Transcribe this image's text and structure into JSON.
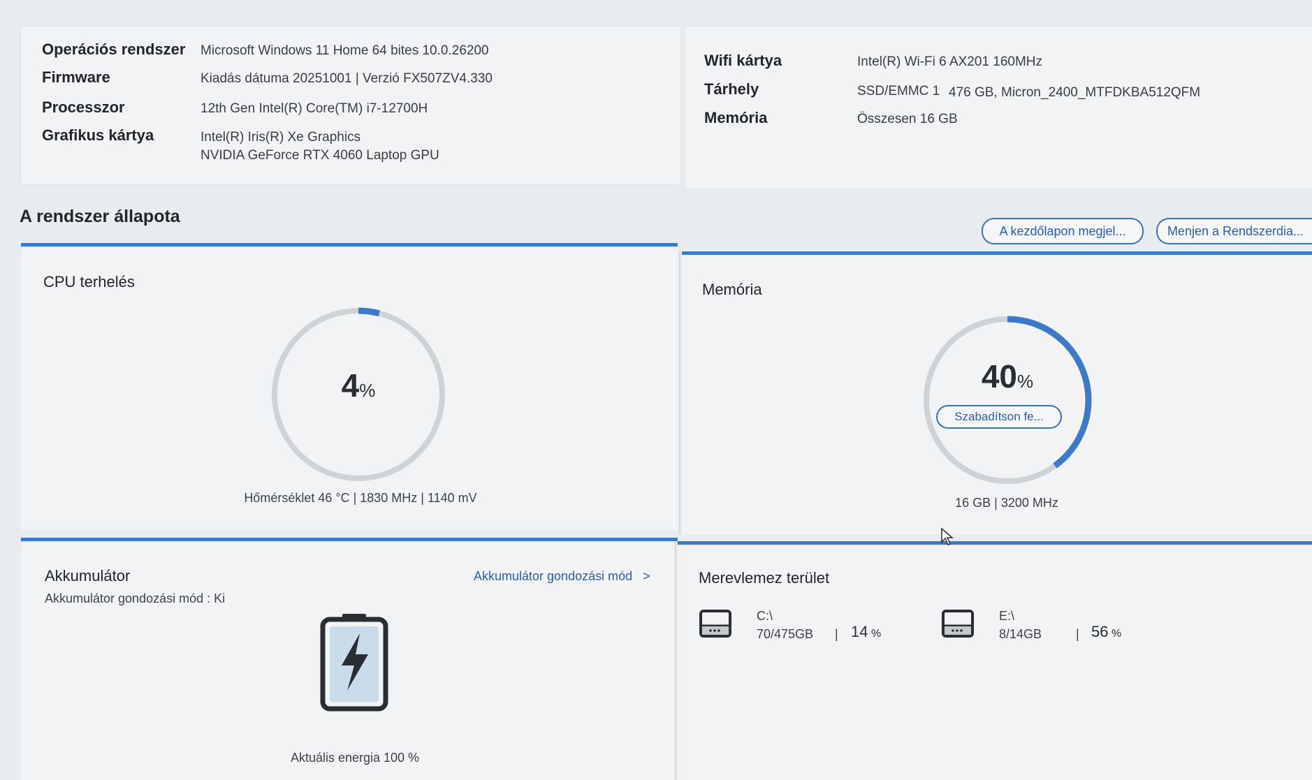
{
  "system_info": {
    "left": [
      {
        "label": "Operációs rendszer",
        "value": "Microsoft Windows 11 Home 64 bites 10.0.26200"
      },
      {
        "label": "Firmware",
        "value": "Kiadás dátuma 20251001 | Verzió FX507ZV4.330"
      },
      {
        "label": "Processzor",
        "value": "12th Gen Intel(R) Core(TM) i7-12700H"
      },
      {
        "label": "Grafikus kártya",
        "value": "Intel(R) Iris(R) Xe Graphics",
        "value2": "NVIDIA GeForce RTX 4060 Laptop GPU"
      }
    ],
    "right": [
      {
        "label": "Wifi kártya",
        "value": "Intel(R) Wi-Fi 6 AX201 160MHz"
      },
      {
        "label": "Tárhely",
        "value": "SSD/EMMC 1",
        "value2": "476 GB, Micron_2400_MTFDKBA512QFM"
      },
      {
        "label": "Memória",
        "value": "Összesen 16 GB"
      }
    ]
  },
  "status": {
    "title": "A rendszer állapota",
    "home_button": "A kezdőlapon megjel...",
    "goto_button": "Menjen a Rendszerdia..."
  },
  "cpu": {
    "title": "CPU terhelés",
    "value": "4",
    "unit": "%",
    "percent": 4,
    "details": "Hőmérséklet 46 °C  |  1830 MHz  |  1140 mV"
  },
  "memory": {
    "title": "Memória",
    "value": "40",
    "unit": "%",
    "percent": 40,
    "free_button": "Szabadítson fe...",
    "details": "16 GB  |  3200 MHz"
  },
  "battery": {
    "title": "Akkumulátor",
    "care_link": "Akkumulátor gondozási mód",
    "care_link_arrow": ">",
    "care_status": "Akkumulátor gondozási mód   : Ki",
    "energy": "Aktuális energia 100 %",
    "icon": "battery-charging-icon",
    "level": 100
  },
  "disks": {
    "title": "Merevlemez terület",
    "items": [
      {
        "name": "C:\\",
        "usage": "70/475GB",
        "sep": "|",
        "percent": "14",
        "unit": "%",
        "icon": "hard-drive-icon"
      },
      {
        "name": "E:\\",
        "usage": "8/14GB",
        "sep": "|",
        "percent": "56",
        "unit": "%",
        "icon": "hard-drive-icon"
      }
    ]
  },
  "colors": {
    "accent": "#3d79c9",
    "ring_track": "#cfd3d6",
    "ring_fill": "#3d79c9"
  }
}
